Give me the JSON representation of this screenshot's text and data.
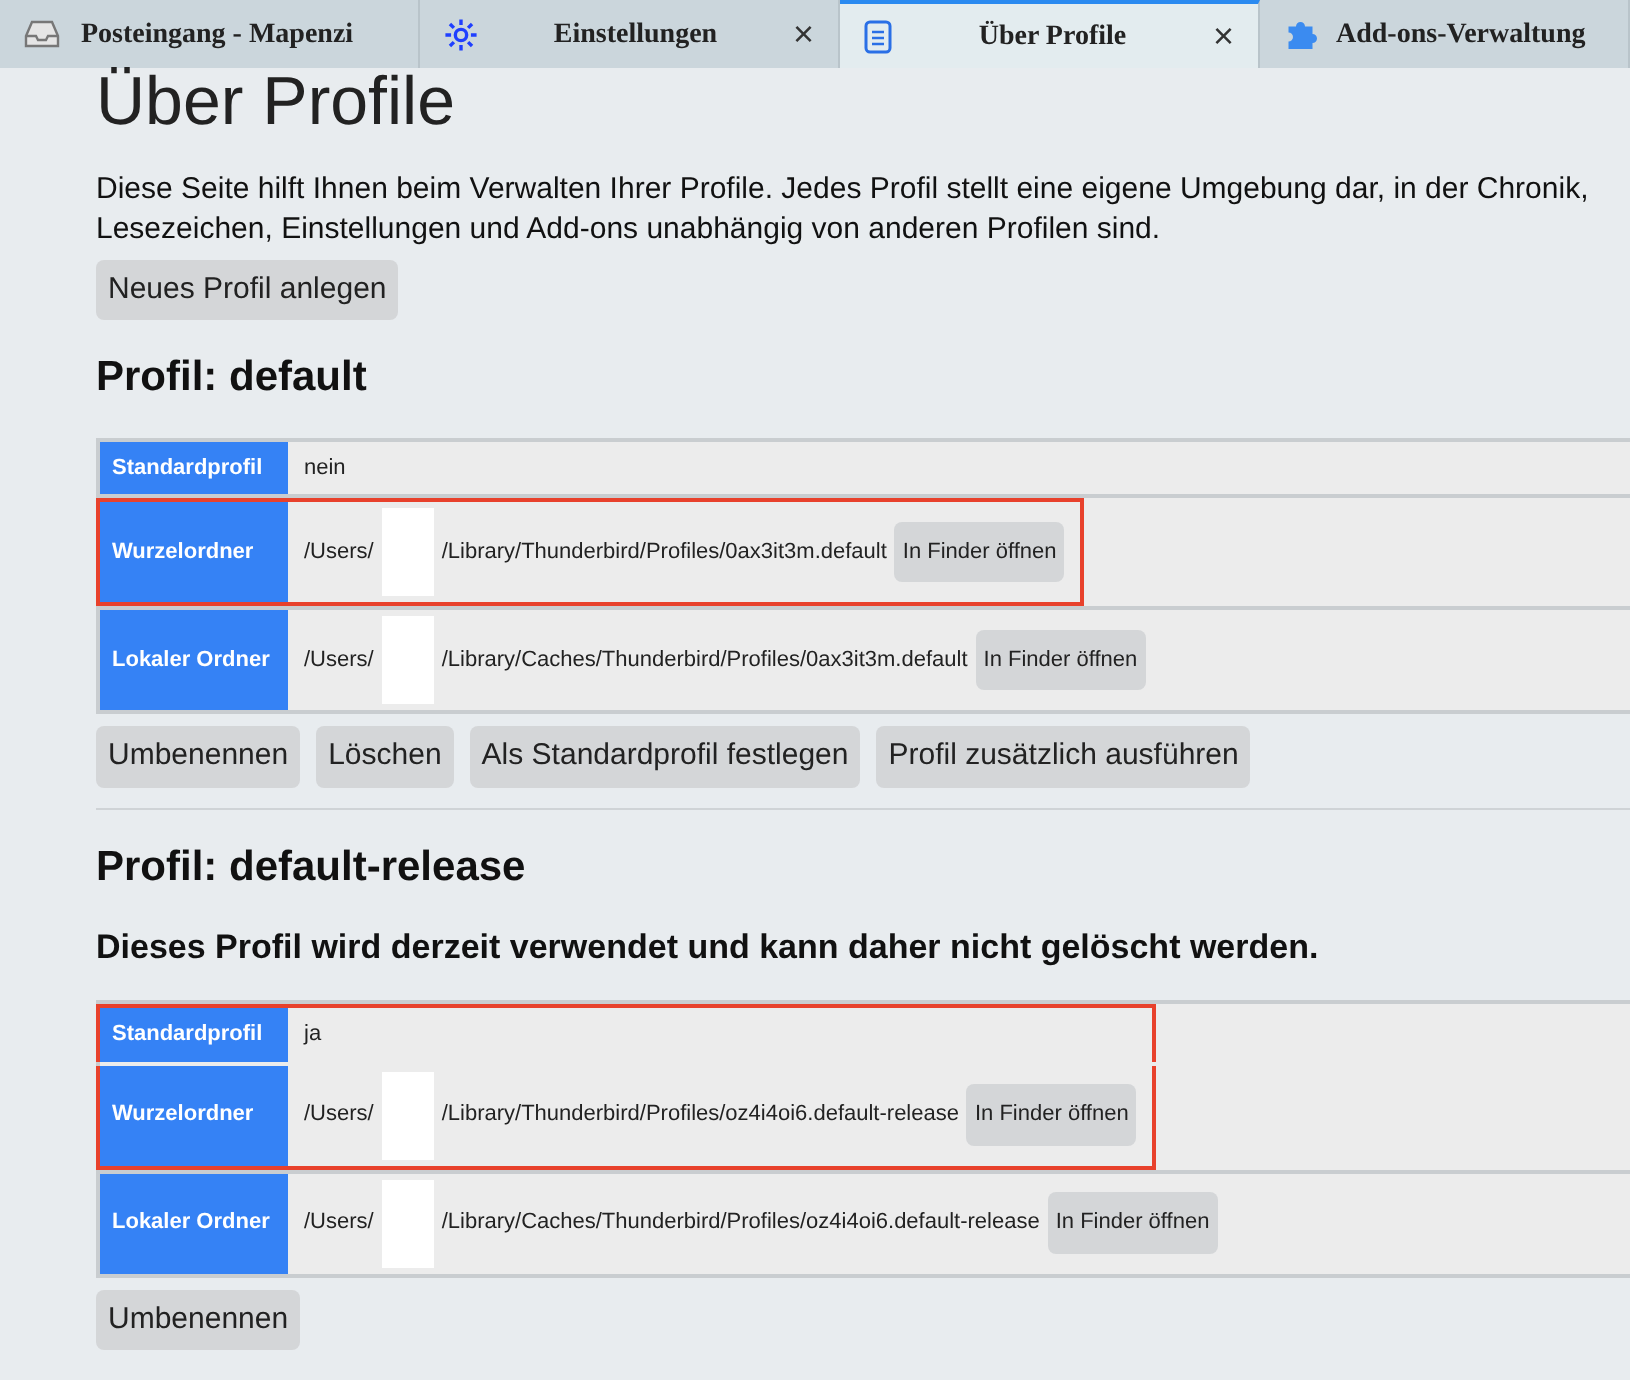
{
  "tabs": [
    {
      "label": "Posteingang - Mapenzi",
      "selected": false,
      "closable": false
    },
    {
      "label": "Einstellungen",
      "selected": false,
      "closable": true
    },
    {
      "label": "Über Profile",
      "selected": true,
      "closable": true
    },
    {
      "label": "Add-ons-Verwaltung",
      "selected": false,
      "closable": false
    }
  ],
  "close_glyph": "×",
  "page": {
    "title": "Über Profile",
    "intro": "Diese Seite hilft Ihnen beim Verwalten Ihrer Profile. Jedes Profil stellt eine eigene Umgebung dar, in der Chronik, Lesezeichen, Einstellungen und Add-ons unabhängig von anderen Profilen sind.",
    "new_profile_button": "Neues Profil anlegen",
    "profiles": [
      {
        "heading": "Profil: default",
        "rows": [
          {
            "label": "Standardprofil",
            "kind": "text",
            "value": "nein",
            "highlighted": false
          },
          {
            "label": "Wurzelordner",
            "kind": "path",
            "path_start": "/Users/",
            "path_end": "/Library/Thunderbird/Profiles/0ax3it3m.default",
            "button": "In Finder öffnen",
            "highlighted": true
          },
          {
            "label": "Lokaler Ordner",
            "kind": "path",
            "path_start": "/Users/",
            "path_end": "/Library/Caches/Thunderbird/Profiles/0ax3it3m.default",
            "button": "In Finder öffnen",
            "highlighted": false
          }
        ],
        "actions": [
          "Umbenennen",
          "Löschen",
          "Als Standardprofil festlegen",
          "Profil zusätzlich ausführen"
        ]
      },
      {
        "heading": "Profil: default-release",
        "note": "Dieses Profil wird derzeit verwendet und kann daher nicht gelöscht werden.",
        "rows": [
          {
            "label": "Standardprofil",
            "kind": "text",
            "value": "ja",
            "highlighted": true
          },
          {
            "label": "Wurzelordner",
            "kind": "path",
            "path_start": "/Users/",
            "path_end": "/Library/Thunderbird/Profiles/oz4i4oi6.default-release",
            "button": "In Finder öffnen",
            "highlighted": true
          },
          {
            "label": "Lokaler Ordner",
            "kind": "path",
            "path_start": "/Users/",
            "path_end": "/Library/Caches/Thunderbird/Profiles/oz4i4oi6.default-release",
            "button": "In Finder öffnen",
            "highlighted": false
          }
        ],
        "actions": [
          "Umbenennen"
        ]
      }
    ]
  }
}
